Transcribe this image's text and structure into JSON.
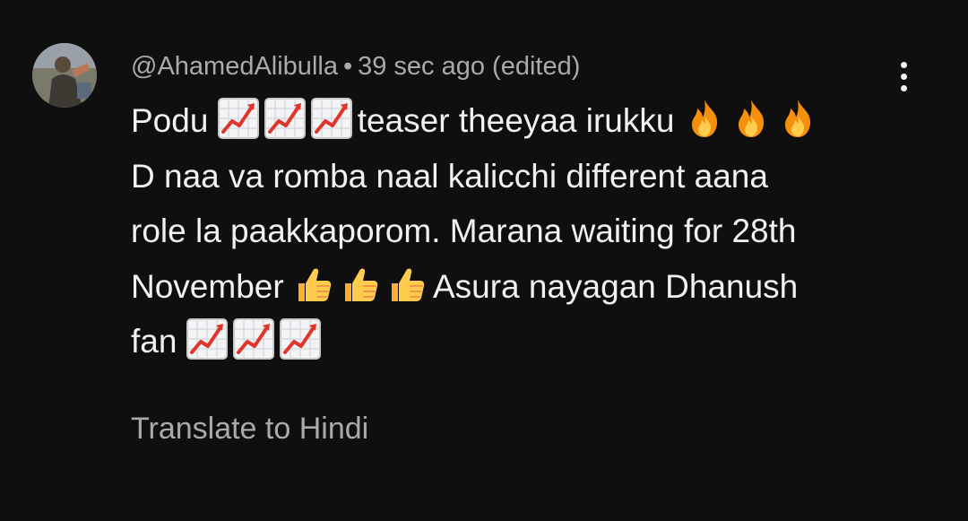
{
  "comment": {
    "author": "@AhamedAlibulla",
    "separator": "•",
    "time": "39 sec ago (edited)",
    "lines": [
      {
        "pre": "Podu",
        "emoji_before": {
          "icon": "chart-increasing-icon",
          "count": 3
        },
        "post": "teaser theeyaa irukku",
        "emoji_after": {
          "icon": "fire-icon",
          "count": 3
        }
      },
      {
        "text": "D naa va romba naal kalicchi different aana"
      },
      {
        "text": "role la paakkaporom. Marana waiting for 28th"
      },
      {
        "pre": "November",
        "emoji": {
          "icon": "thumbs-up-icon",
          "count": 3
        },
        "post": "Asura nayagan Dhanush"
      },
      {
        "pre": "fan",
        "emoji": {
          "icon": "chart-increasing-icon",
          "count": 3
        }
      }
    ],
    "translate_label": "Translate to Hindi",
    "avatar_icon": "avatar",
    "more_icon": "more-vert-icon"
  },
  "colors": {
    "background": "#0f0f0f",
    "primary_text": "#f1f1f1",
    "secondary_text": "#aaaaaa"
  }
}
